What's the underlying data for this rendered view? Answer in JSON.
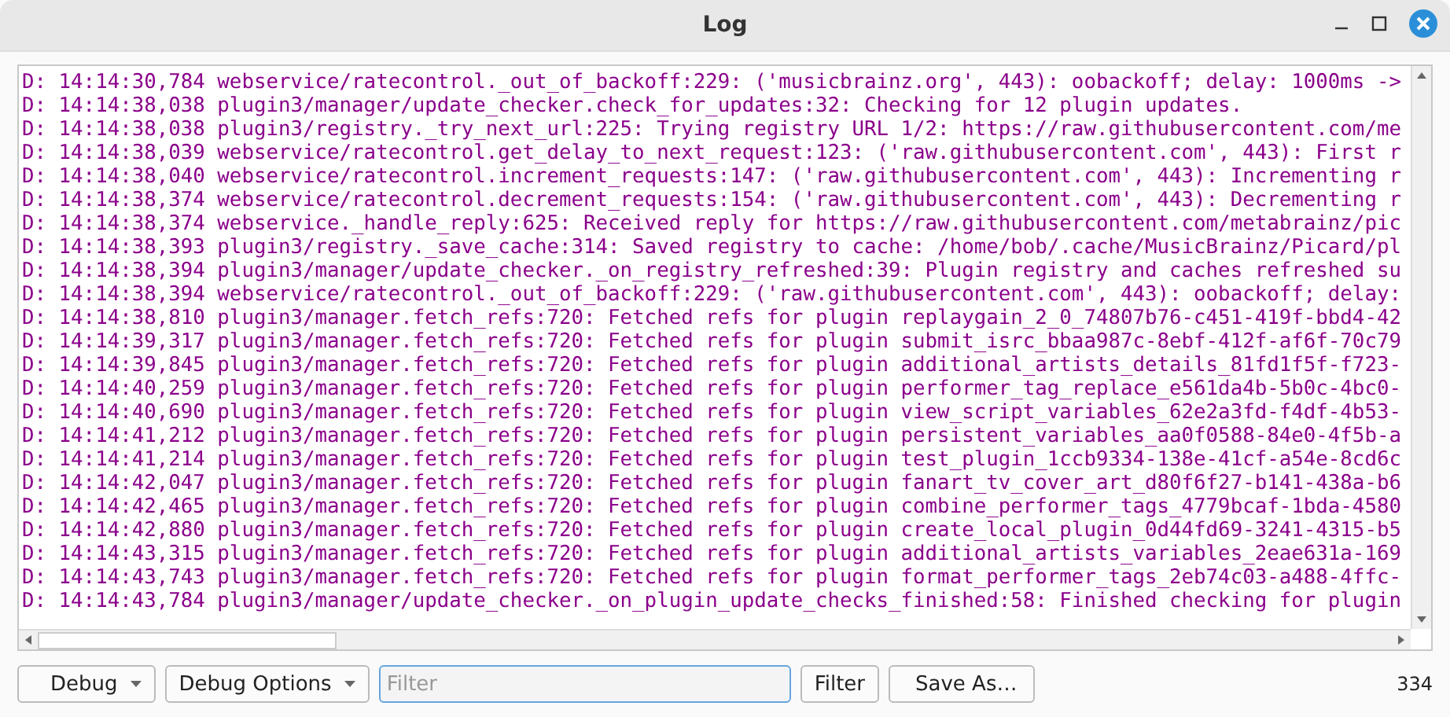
{
  "window": {
    "title": "Log"
  },
  "log_lines": [
    "D: 14:14:30,784 webservice/ratecontrol._out_of_backoff:229: ('musicbrainz.org', 443): oobackoff; delay: 1000ms ->",
    "D: 14:14:38,038 plugin3/manager/update_checker.check_for_updates:32: Checking for 12 plugin updates.",
    "D: 14:14:38,038 plugin3/registry._try_next_url:225: Trying registry URL 1/2: https://raw.githubusercontent.com/me",
    "D: 14:14:38,039 webservice/ratecontrol.get_delay_to_next_request:123: ('raw.githubusercontent.com', 443): First r",
    "D: 14:14:38,040 webservice/ratecontrol.increment_requests:147: ('raw.githubusercontent.com', 443): Incrementing r",
    "D: 14:14:38,374 webservice/ratecontrol.decrement_requests:154: ('raw.githubusercontent.com', 443): Decrementing r",
    "D: 14:14:38,374 webservice._handle_reply:625: Received reply for https://raw.githubusercontent.com/metabrainz/pic",
    "D: 14:14:38,393 plugin3/registry._save_cache:314: Saved registry to cache: /home/bob/.cache/MusicBrainz/Picard/pl",
    "D: 14:14:38,394 plugin3/manager/update_checker._on_registry_refreshed:39: Plugin registry and caches refreshed su",
    "D: 14:14:38,394 webservice/ratecontrol._out_of_backoff:229: ('raw.githubusercontent.com', 443): oobackoff; delay:",
    "D: 14:14:38,810 plugin3/manager.fetch_refs:720: Fetched refs for plugin replaygain_2_0_74807b76-c451-419f-bbd4-42",
    "D: 14:14:39,317 plugin3/manager.fetch_refs:720: Fetched refs for plugin submit_isrc_bbaa987c-8ebf-412f-af6f-70c79",
    "D: 14:14:39,845 plugin3/manager.fetch_refs:720: Fetched refs for plugin additional_artists_details_81fd1f5f-f723-",
    "D: 14:14:40,259 plugin3/manager.fetch_refs:720: Fetched refs for plugin performer_tag_replace_e561da4b-5b0c-4bc0-",
    "D: 14:14:40,690 plugin3/manager.fetch_refs:720: Fetched refs for plugin view_script_variables_62e2a3fd-f4df-4b53-",
    "D: 14:14:41,212 plugin3/manager.fetch_refs:720: Fetched refs for plugin persistent_variables_aa0f0588-84e0-4f5b-a",
    "D: 14:14:41,214 plugin3/manager.fetch_refs:720: Fetched refs for plugin test_plugin_1ccb9334-138e-41cf-a54e-8cd6c",
    "D: 14:14:42,047 plugin3/manager.fetch_refs:720: Fetched refs for plugin fanart_tv_cover_art_d80f6f27-b141-438a-b6",
    "D: 14:14:42,465 plugin3/manager.fetch_refs:720: Fetched refs for plugin combine_performer_tags_4779bcaf-1bda-4580",
    "D: 14:14:42,880 plugin3/manager.fetch_refs:720: Fetched refs for plugin create_local_plugin_0d44fd69-3241-4315-b5",
    "D: 14:14:43,315 plugin3/manager.fetch_refs:720: Fetched refs for plugin additional_artists_variables_2eae631a-169",
    "D: 14:14:43,743 plugin3/manager.fetch_refs:720: Fetched refs for plugin format_performer_tags_2eb74c03-a488-4ffc-",
    "D: 14:14:43,784 plugin3/manager/update_checker._on_plugin_update_checks_finished:58: Finished checking for plugin"
  ],
  "toolbar": {
    "level_dropdown": "Debug",
    "options_dropdown": "Debug Options",
    "filter_field": {
      "placeholder": "Filter"
    },
    "filter_button": "Filter",
    "save_button": "Save As…",
    "count": "334"
  }
}
